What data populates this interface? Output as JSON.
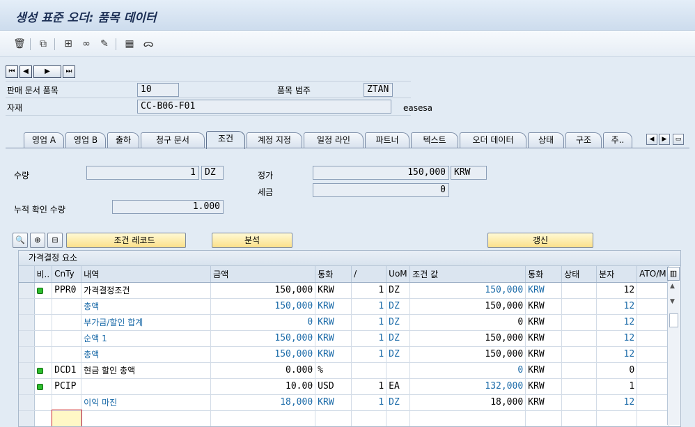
{
  "window": {
    "title": "생성 표준 오더: 품목 데이터"
  },
  "toolbar": {
    "icons": [
      "trash-icon",
      "document-overview-icon",
      "item-grid-icon",
      "binoculars-icon",
      "edit-icon",
      "calculator-icon",
      "glasses-icon"
    ]
  },
  "header": {
    "sales_doc_item_label": "판매 문서 품목",
    "sales_doc_item_value": "10",
    "item_category_label": "품목 범주",
    "item_category_value": "ZTAN",
    "material_label": "자재",
    "material_value": "CC-B06-F01",
    "material_desc": "easesa"
  },
  "tabs": [
    "영업 A",
    "영업 B",
    "출하",
    "청구 문서",
    "조건",
    "계정 지정",
    "일정 라인",
    "파트너",
    "텍스트",
    "오더 데이터",
    "상태",
    "구조",
    "추.."
  ],
  "active_tab": "조건",
  "conditions": {
    "qty_label": "수량",
    "qty_value": "1",
    "qty_unit": "DZ",
    "cum_confirmed_label": "누적 확인 수량",
    "cum_confirmed_value": "1.000",
    "net_label": "정가",
    "net_value": "150,000",
    "net_currency": "KRW",
    "tax_label": "세금",
    "tax_value": "0"
  },
  "buttons": {
    "condition_record": "조건 레코드",
    "analysis": "분석",
    "update": "갱신"
  },
  "grid": {
    "title": "가격결정 요소",
    "columns": [
      "비..",
      "CnTy",
      "내역",
      "금액",
      "통화",
      "/",
      "UoM",
      "조건 값",
      "통화",
      "상태",
      "분자",
      "ATO/M"
    ],
    "rows": [
      {
        "led": true,
        "cnty": "PPR0",
        "desc": "가격결정조건",
        "amount": "150,000",
        "curr": "KRW",
        "per": "1",
        "uom": "DZ",
        "value": "150,000",
        "vcurr": "KRW",
        "status": "",
        "num": "12",
        "blue": false,
        "first": true
      },
      {
        "led": false,
        "cnty": "",
        "desc": "총액",
        "amount": "150,000",
        "curr": "KRW",
        "per": "1",
        "uom": "DZ",
        "value": "150,000",
        "vcurr": "KRW",
        "status": "",
        "num": "12",
        "blue": true
      },
      {
        "led": false,
        "cnty": "",
        "desc": "부가금/할인 합계",
        "amount": "0",
        "curr": "KRW",
        "per": "1",
        "uom": "DZ",
        "value": "0",
        "vcurr": "KRW",
        "status": "",
        "num": "12",
        "blue": true
      },
      {
        "led": false,
        "cnty": "",
        "desc": "순액 1",
        "amount": "150,000",
        "curr": "KRW",
        "per": "1",
        "uom": "DZ",
        "value": "150,000",
        "vcurr": "KRW",
        "status": "",
        "num": "12",
        "blue": true
      },
      {
        "led": false,
        "cnty": "",
        "desc": "총액",
        "amount": "150,000",
        "curr": "KRW",
        "per": "1",
        "uom": "DZ",
        "value": "150,000",
        "vcurr": "KRW",
        "status": "",
        "num": "12",
        "blue": true
      },
      {
        "led": true,
        "cnty": "DCD1",
        "desc": "현금 할인 총액",
        "amount": "0.000",
        "curr": "%",
        "per": "",
        "uom": "",
        "value": "0",
        "vcurr": "KRW",
        "status": "",
        "num": "0",
        "blue": false
      },
      {
        "led": true,
        "cnty": "PCIP",
        "desc": "",
        "amount": "10.00",
        "curr": "USD",
        "per": "1",
        "uom": "EA",
        "value": "132,000",
        "vcurr": "KRW",
        "status": "",
        "num": "1",
        "blue": false
      },
      {
        "led": false,
        "cnty": "",
        "desc": "이익 마진",
        "amount": "18,000",
        "curr": "KRW",
        "per": "1",
        "uom": "DZ",
        "value": "18,000",
        "vcurr": "KRW",
        "status": "",
        "num": "12",
        "blue": true
      }
    ]
  }
}
